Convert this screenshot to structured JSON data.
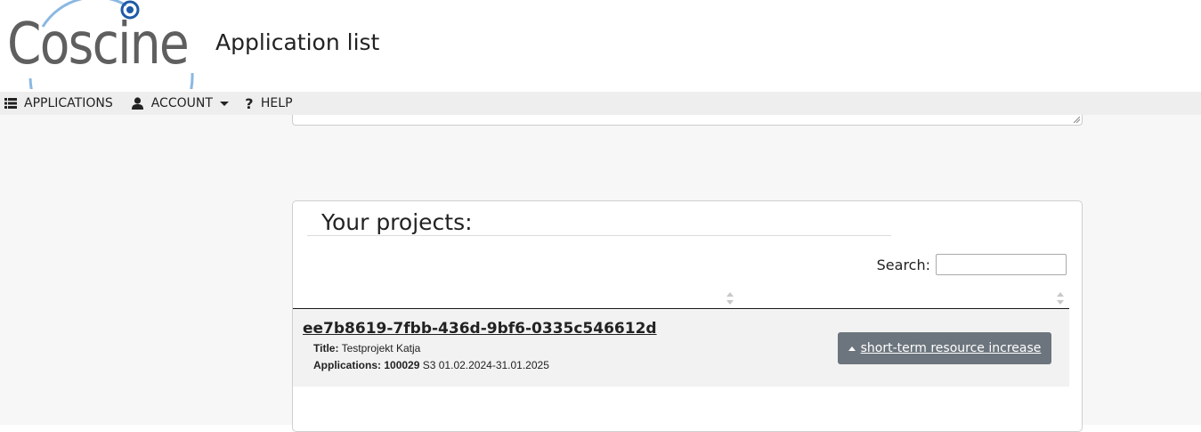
{
  "header": {
    "logo_text": "Coscine",
    "page_title": "Application list"
  },
  "nav": {
    "items": [
      {
        "label": "APPLICATIONS",
        "icon": "list-icon"
      },
      {
        "label": "ACCOUNT",
        "icon": "user-icon"
      },
      {
        "label": "HELP",
        "icon": "question-icon"
      }
    ]
  },
  "projects_panel": {
    "title": "Your projects:",
    "search_label": "Search:",
    "search_value": "",
    "rows": [
      {
        "id": "ee7b8619-7fbb-436d-9bf6-0335c546612d",
        "title_label": "Title:",
        "title_value": "Testprojekt Katja",
        "applications_label": "Applications:",
        "applications_number": "100029",
        "applications_detail": "S3 01.02.2024-31.01.2025",
        "action_label": "short-term resource increase"
      }
    ]
  },
  "colors": {
    "nav_bg": "#eeeeee",
    "button_bg": "#6c757d",
    "logo_ring": "#7fb2df",
    "logo_dot": "#1f5aa6"
  }
}
